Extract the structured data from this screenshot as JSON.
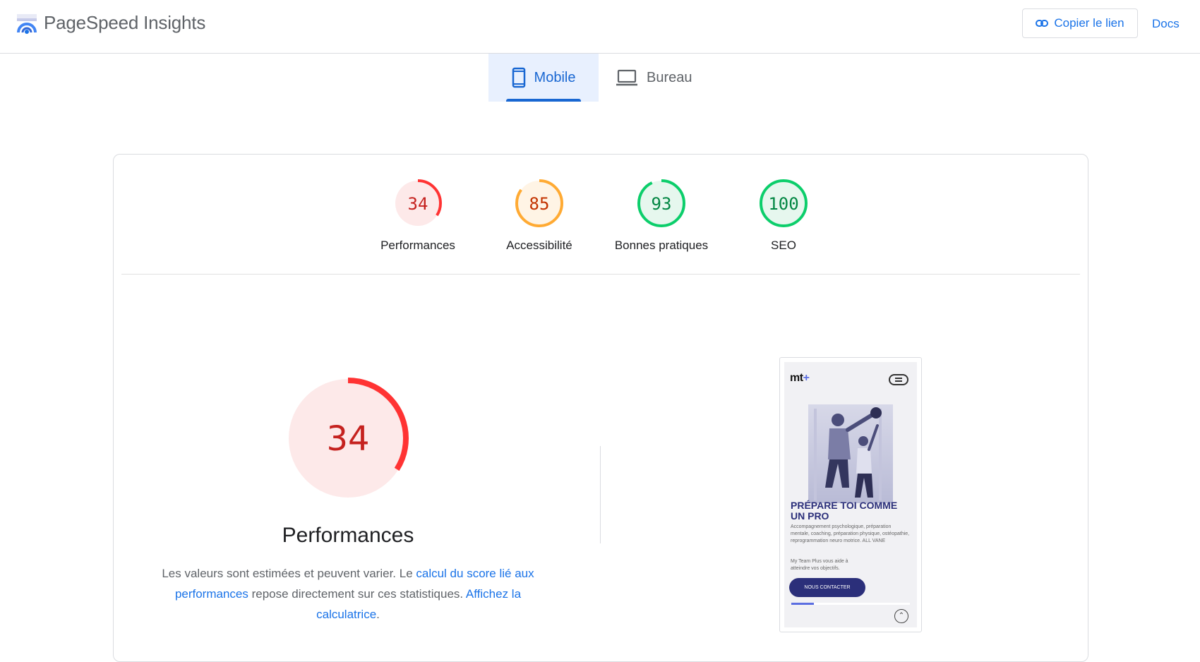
{
  "header": {
    "app_title": "PageSpeed Insights",
    "copy_link_label": "Copier le lien",
    "docs_label": "Docs"
  },
  "tabs": [
    {
      "label": "Mobile",
      "icon": "smartphone-icon",
      "selected": true
    },
    {
      "label": "Bureau",
      "icon": "laptop-icon",
      "selected": false
    }
  ],
  "scores": [
    {
      "value": 34,
      "label": "Performances",
      "status": "poor"
    },
    {
      "value": 85,
      "label": "Accessibilité",
      "status": "average"
    },
    {
      "value": 93,
      "label": "Bonnes pratiques",
      "status": "good"
    },
    {
      "value": 100,
      "label": "SEO",
      "status": "good"
    }
  ],
  "status_colors": {
    "poor": {
      "stroke": "#f33",
      "fill": "#fde9e9",
      "text": "#c5221f"
    },
    "average": {
      "stroke": "#ffaa33",
      "fill": "#fff4e5",
      "text": "#c33300"
    },
    "good": {
      "stroke": "#0cce6b",
      "fill": "#e6f7ee",
      "text": "#018642"
    }
  },
  "performance": {
    "score": 34,
    "title": "Performances",
    "desc_text_1": "Les valeurs sont estimées et peuvent varier. Le ",
    "desc_link_1": "calcul du score lié aux performances",
    "desc_text_2": " repose directement sur ces statistiques. ",
    "desc_link_2": "Affichez la calculatrice",
    "desc_text_3": "."
  },
  "screenshot": {
    "logo_text": "mt",
    "logo_plus": "+",
    "headline": "PRÉPARE TOI COMME UN PRO",
    "body": "Accompagnement psychologique, préparation mentale, coaching, préparation physique, ostéopathie, reprogrammation neuro motrice. ALL VANE",
    "body2": "My Team Plus vous aide à atteindre vos objectifs.",
    "cta": "NOUS CONTACTER"
  }
}
